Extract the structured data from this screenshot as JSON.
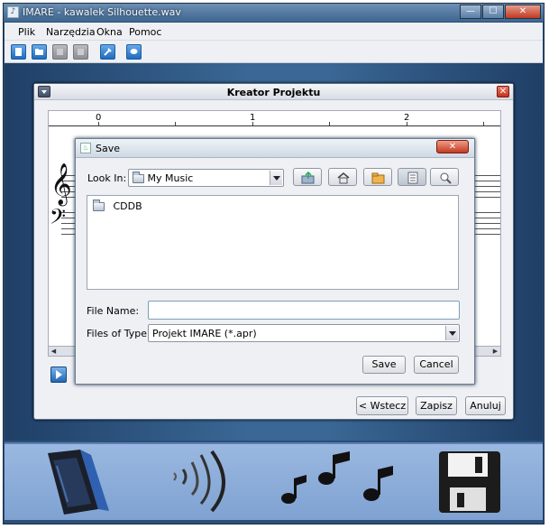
{
  "app": {
    "title": "IMARE - kawalek Silhouette.wav",
    "window_controls": [
      "minimize",
      "maximize",
      "close"
    ]
  },
  "menu": {
    "items": [
      "Plik",
      "Narzędzia",
      "Okna",
      "Pomoc"
    ]
  },
  "toolbar": {
    "buttons": [
      {
        "icon": "new-document-icon",
        "enabled": true
      },
      {
        "icon": "open-folder-icon",
        "enabled": true
      },
      {
        "icon": "save-icon",
        "enabled": false
      },
      {
        "icon": "export-icon",
        "enabled": false
      },
      {
        "icon": "tools-icon",
        "enabled": true
      },
      {
        "icon": "help-chat-icon",
        "enabled": true
      }
    ]
  },
  "kreator": {
    "title": "Kreator Projektu",
    "ruler": [
      "0",
      "1",
      "2"
    ],
    "buttons": {
      "back": "< Wstecz",
      "save": "Zapisz",
      "cancel": "Anuluj"
    }
  },
  "save_dialog": {
    "title": "Save",
    "look_in_label": "Look In:",
    "look_in_value": "My Music",
    "files": [
      "CDDB"
    ],
    "file_name_label": "File Name:",
    "file_name_value": "",
    "files_of_type_label": "Files of Type:",
    "files_of_type_value": "Projekt IMARE (*.apr)",
    "save_button": "Save",
    "cancel_button": "Cancel"
  },
  "bottom_bar": {
    "icons": [
      "phone-device-icon",
      "sound-waves-icon",
      "music-notes-icon",
      "floppy-disk-icon"
    ]
  },
  "colors": {
    "workspace": "#3a6795",
    "bottom_bar": "#8fb0dc",
    "accent_blue": "#1e6cc0",
    "close_red": "#c43a22"
  }
}
